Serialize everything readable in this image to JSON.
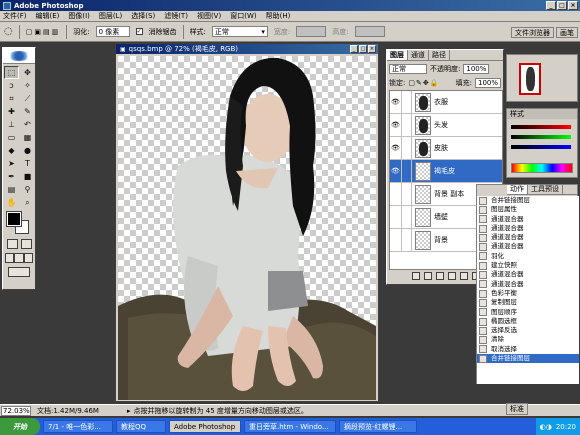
{
  "app": {
    "title": "Adobe Photoshop"
  },
  "menu": [
    "文件(F)",
    "编辑(E)",
    "图像(I)",
    "图层(L)",
    "选择(S)",
    "滤镜(T)",
    "视图(V)",
    "窗口(W)",
    "帮助(H)"
  ],
  "options": {
    "feather_label": "羽化:",
    "feather_value": "0 像素",
    "antialias_label": "消除锯齿",
    "style_label": "样式:",
    "style_value": "正常",
    "width_label": "宽度:",
    "height_label": "高度:",
    "tab_file_browser": "文件浏览器",
    "tab_brushes": "画笔"
  },
  "document": {
    "title": "qsqs.bmp @ 72% (褐毛皮, RGB)"
  },
  "layers_panel": {
    "tabs": [
      "图层",
      "通道",
      "路径"
    ],
    "blend_mode": "正常",
    "opacity_label": "不透明度:",
    "opacity_value": "100%",
    "lock_label": "锁定:",
    "fill_label": "填充:",
    "fill_value": "100%",
    "layers": [
      {
        "name": "衣服",
        "visible": true,
        "selected": false
      },
      {
        "name": "头发",
        "visible": true,
        "selected": false
      },
      {
        "name": "皮肤",
        "visible": true,
        "selected": false
      },
      {
        "name": "褐毛皮",
        "visible": true,
        "selected": true
      },
      {
        "name": "背景 副本",
        "visible": false,
        "selected": false
      },
      {
        "name": "墙壁",
        "visible": false,
        "selected": false
      },
      {
        "name": "背景",
        "visible": false,
        "selected": false
      }
    ]
  },
  "color_panel": {
    "title": "样式"
  },
  "actions_panel": {
    "tabs": [
      "动作",
      "工具预设"
    ],
    "items": [
      "合并链接图层",
      "图层属性",
      "通道混合器",
      "通道混合器",
      "通道混合器",
      "通道混合器",
      "羽化",
      "建立快照",
      "通道混合器",
      "通道混合器",
      "色彩平衡",
      "复制图层",
      "图层顺序",
      "椭圆选框",
      "选择反选",
      "清除",
      "取消选择",
      "合并链接图层"
    ]
  },
  "status": {
    "zoom": "72.03%",
    "doc_size": "文档:1.42M/9.46M",
    "message": "点按并拖移以旋转制为 45 度增量方向移动图层或选区。"
  },
  "ime": "标准",
  "taskbar": {
    "start": "开始",
    "tasks": [
      "7/1 - 唯一色彩...",
      "教程QQ",
      "Adobe Photoshop",
      "重日旁草.htm - Windo...",
      "摘段预览-红螺锂..."
    ],
    "clock": "20:20"
  }
}
